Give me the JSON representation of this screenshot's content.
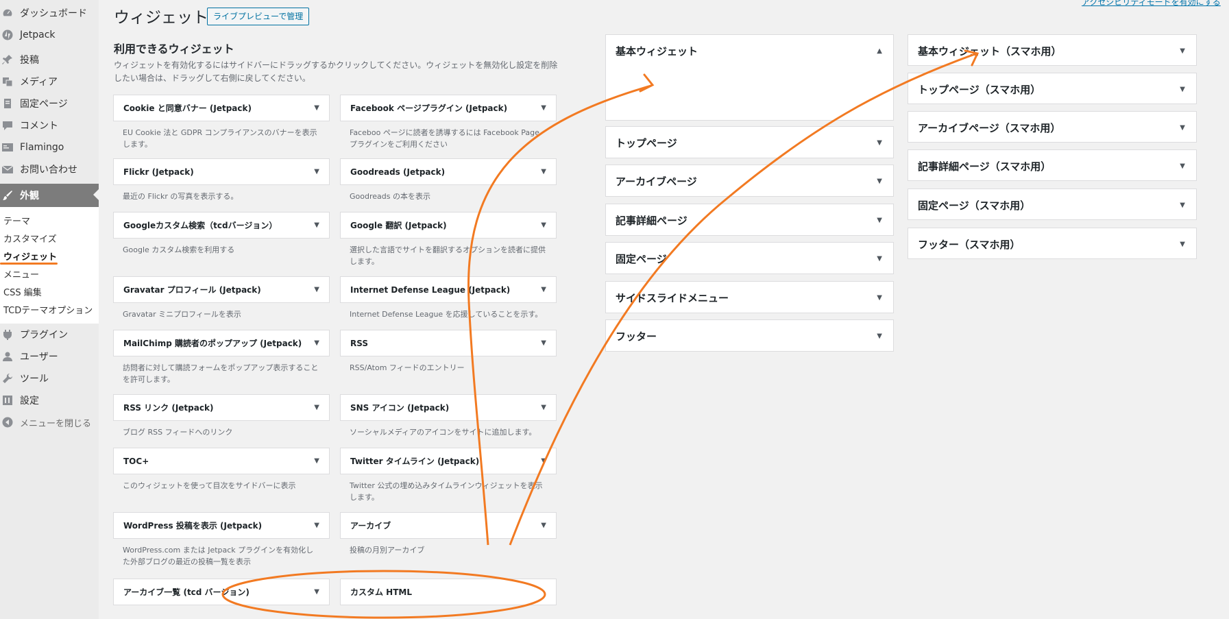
{
  "sidebar": {
    "items": [
      {
        "label": "ダッシュボード",
        "icon": "dashboard-icon"
      },
      {
        "label": "Jetpack",
        "icon": "jetpack-icon"
      },
      {
        "label": "投稿",
        "icon": "pin-icon"
      },
      {
        "label": "メディア",
        "icon": "media-icon"
      },
      {
        "label": "固定ページ",
        "icon": "page-icon"
      },
      {
        "label": "コメント",
        "icon": "comment-icon"
      },
      {
        "label": "Flamingo",
        "icon": "flamingo-icon"
      },
      {
        "label": "お問い合わせ",
        "icon": "mail-icon"
      },
      {
        "label": "外観",
        "icon": "brush-icon"
      }
    ],
    "submenu": [
      "テーマ",
      "カスタマイズ",
      "ウィジェット",
      "メニュー",
      "CSS 編集",
      "TCDテーマオプション"
    ],
    "lower_items": [
      {
        "label": "プラグイン",
        "icon": "plugin-icon"
      },
      {
        "label": "ユーザー",
        "icon": "user-icon"
      },
      {
        "label": "ツール",
        "icon": "wrench-icon"
      },
      {
        "label": "設定",
        "icon": "settings-icon"
      }
    ],
    "collapse_label": "メニューを閉じる"
  },
  "header": {
    "title": "ウィジェット",
    "live_preview_label": "ライブプレビューで管理",
    "a11y_link": "アクセシビリティモードを有効にする"
  },
  "available": {
    "title": "利用できるウィジェット",
    "description": "ウィジェットを有効化するにはサイドバーにドラッグするかクリックしてください。ウィジェットを無効化し設定を削除したい場合は、ドラッグして右側に戻してください。",
    "widgets": [
      {
        "name": "Cookie と同意バナー (Jetpack)",
        "desc": "EU Cookie 法と GDPR コンプライアンスのバナーを表示します。"
      },
      {
        "name": "Facebook ページプラグイン (Jetpack)",
        "desc": "Faceboo ページに読者を誘導するには Facebook Page プラグインをご利用ください"
      },
      {
        "name": "Flickr (Jetpack)",
        "desc": "最近の Flickr の写真を表示する。"
      },
      {
        "name": "Goodreads (Jetpack)",
        "desc": "Goodreads の本を表示"
      },
      {
        "name": "Googleカスタム検索（tcdバージョン）",
        "desc": "Google カスタム検索を利用する"
      },
      {
        "name": "Google 翻訳 (Jetpack)",
        "desc": "選択した言語でサイトを翻訳するオプションを読者に提供します。"
      },
      {
        "name": "Gravatar プロフィール (Jetpack)",
        "desc": "Gravatar ミニプロフィールを表示"
      },
      {
        "name": "Internet Defense League (Jetpack)",
        "desc": "Internet Defense League を応援していることを示す。"
      },
      {
        "name": "MailChimp 購読者のポップアップ (Jetpack)",
        "desc": "訪問者に対して購読フォームをポップアップ表示することを許可します。"
      },
      {
        "name": "RSS",
        "desc": "RSS/Atom フィードのエントリー"
      },
      {
        "name": "RSS リンク (Jetpack)",
        "desc": "ブログ RSS フィードへのリンク"
      },
      {
        "name": "SNS アイコン (Jetpack)",
        "desc": "ソーシャルメディアのアイコンをサイトに追加します。"
      },
      {
        "name": "TOC+",
        "desc": "このウィジェットを使って目次をサイドバーに表示"
      },
      {
        "name": "Twitter タイムライン (Jetpack)",
        "desc": "Twitter 公式の埋め込みタイムラインウィジェットを表示します。"
      },
      {
        "name": "WordPress 投稿を表示 (Jetpack)",
        "desc": "WordPress.com または Jetpack プラグインを有効化した外部ブログの最近の投稿一覧を表示"
      },
      {
        "name": "アーカイブ",
        "desc": "投稿の月別アーカイブ"
      },
      {
        "name": "アーカイブ一覧 (tcd バージョン)",
        "desc": ""
      },
      {
        "name": "カスタム HTML",
        "desc": ""
      }
    ]
  },
  "areas_left": [
    {
      "title": "基本ウィジェット"
    },
    {
      "title": "トップページ"
    },
    {
      "title": "アーカイブページ"
    },
    {
      "title": "記事詳細ページ"
    },
    {
      "title": "固定ページ"
    },
    {
      "title": "サイドスライドメニュー"
    },
    {
      "title": "フッター"
    }
  ],
  "areas_right": [
    {
      "title": "基本ウィジェット（スマホ用）"
    },
    {
      "title": "トップページ（スマホ用）"
    },
    {
      "title": "アーカイブページ（スマホ用）"
    },
    {
      "title": "記事詳細ページ（スマホ用）"
    },
    {
      "title": "固定ページ（スマホ用）"
    },
    {
      "title": "フッター（スマホ用）"
    }
  ],
  "colors": {
    "accent": "#f27a22",
    "current_menu": "#7c7c7c",
    "link": "#0073aa"
  }
}
